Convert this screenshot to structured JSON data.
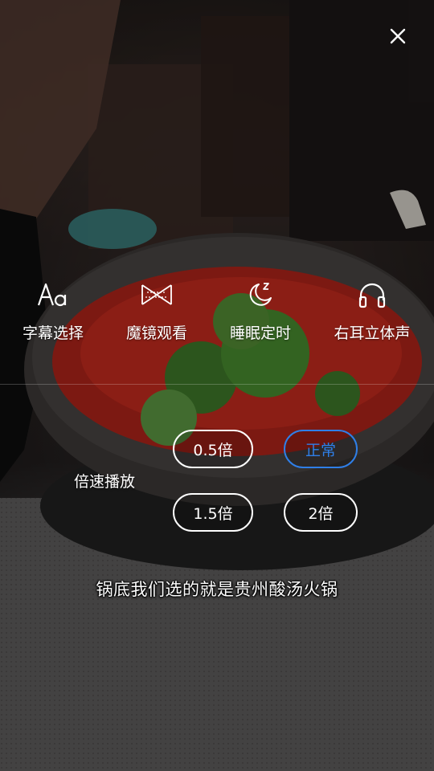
{
  "close": {
    "icon": "close-icon"
  },
  "options": [
    {
      "icon": "font-aa-icon",
      "label": "字幕选择"
    },
    {
      "icon": "mirror-bowtie-icon",
      "label": "魔镜观看"
    },
    {
      "icon": "moon-sleep-icon",
      "label": "睡眠定时"
    },
    {
      "icon": "headphones-icon",
      "label": "右耳立体声"
    }
  ],
  "speed": {
    "title": "倍速播放",
    "options": [
      "0.5倍",
      "正常",
      "1.5倍",
      "2倍"
    ],
    "selected": "正常",
    "accent_color": "#2f7fe8"
  },
  "subtitle": "锅底我们选的就是贵州酸汤火锅"
}
